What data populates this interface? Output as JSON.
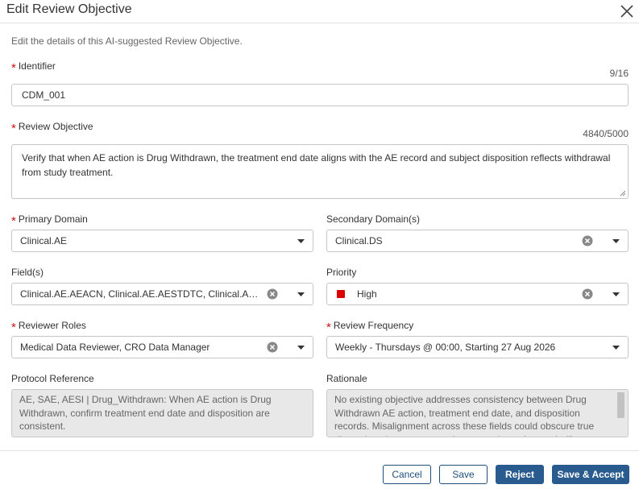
{
  "dialog": {
    "title": "Edit Review Objective",
    "subtitle": "Edit the details of this AI-suggested Review Objective."
  },
  "required_mark": "*",
  "identifier": {
    "label": "Identifier",
    "counter": "9/16",
    "value": "CDM_001"
  },
  "review_objective": {
    "label": "Review Objective",
    "counter": "4840/5000",
    "value": "Verify that when AE action is Drug Withdrawn, the treatment end date aligns with the AE record and subject disposition reflects withdrawal from study treatment."
  },
  "primary_domain": {
    "label": "Primary Domain",
    "value": "Clinical.AE"
  },
  "secondary_domains": {
    "label": "Secondary Domain(s)",
    "value": "Clinical.DS"
  },
  "fields": {
    "label": "Field(s)",
    "value": "Clinical.AE.AEACN, Clinical.AE.AESTDTC, Clinical.AE..."
  },
  "priority": {
    "label": "Priority",
    "value": "High",
    "color": "#dd0000"
  },
  "reviewer_roles": {
    "label": "Reviewer Roles",
    "value": "Medical Data Reviewer, CRO Data Manager"
  },
  "review_frequency": {
    "label": "Review Frequency",
    "value": "Weekly - Thursdays @ 00:00, Starting 27 Aug 2026"
  },
  "protocol_reference": {
    "label": "Protocol Reference",
    "value": "AE, SAE, AESI | Drug_Withdrawn: When AE action is Drug Withdrawn, confirm treatment end date and disposition are consistent."
  },
  "rationale": {
    "label": "Rationale",
    "value": "No existing objective addresses consistency between Drug Withdrawn AE action, treatment end date, and disposition records. Misalignment across these fields could obscure true discontinuation reasons and compromise safety and efficacy analyses."
  },
  "buttons": {
    "cancel": "Cancel",
    "save": "Save",
    "reject": "Reject",
    "save_accept": "Save & Accept"
  },
  "colors": {
    "primary": "#2a5b8e",
    "required": "#cc1111"
  }
}
